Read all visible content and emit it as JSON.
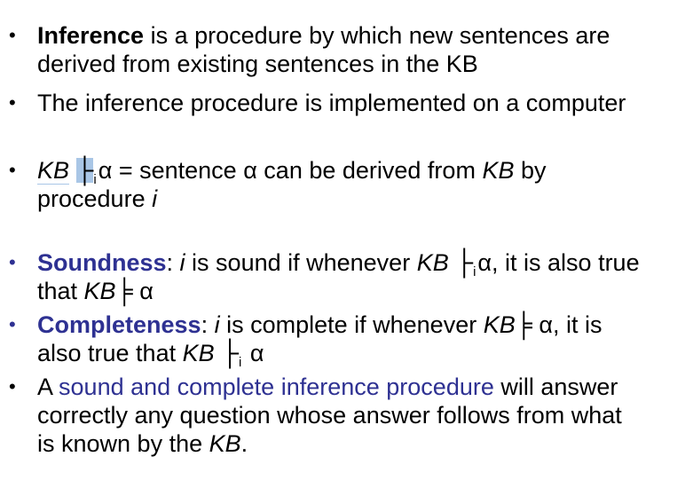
{
  "b1": {
    "term": "Inference",
    "rest1": " is a procedure by which new sentences are",
    "line2": "derived from existing sentences in the KB"
  },
  "b2": {
    "text": "The inference procedure is implemented on a computer"
  },
  "b3": {
    "kb": "KB",
    "turn": "├",
    "sub": "i",
    "rest1": "α = sentence α can be derived from ",
    "kb2": "KB",
    "by": " by",
    "line2a": "procedure ",
    "line2b": "i"
  },
  "b4": {
    "term": "Soundness",
    "colon": ": ",
    "i": "i",
    "mid": " is sound if whenever ",
    "kb": "KB",
    "turn": "├",
    "sub": "i",
    "end": "α, it is also true",
    "line2a": "that ",
    "kb2": "KB",
    "models": "╞",
    "alpha": " α"
  },
  "b5": {
    "term": "Completeness",
    "colon": ": ",
    "i": "i",
    "mid": " is complete if whenever ",
    "kb": "KB",
    "models": "╞",
    "end": " α, it is",
    "line2a": "also true that ",
    "kb2": "KB",
    "turn": "├",
    "sub": "i",
    "alpha": " α"
  },
  "b6": {
    "a": "A ",
    "phrase": "sound and complete inference procedure",
    "rest1": " will answer",
    "line2": "correctly any question whose answer follows from what",
    "line3a": "is known by the ",
    "kb": "KB",
    "period": "."
  },
  "bullet_char": "•",
  "colors": {
    "accent": "#2e3192",
    "highlight": "#a9c6e6"
  }
}
